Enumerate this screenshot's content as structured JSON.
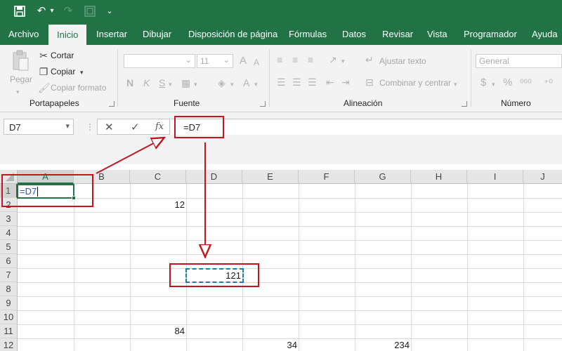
{
  "qat": {
    "save_icon": "save-icon",
    "undo_icon": "undo-icon",
    "redo_icon": "redo-icon",
    "form_icon": "form-icon",
    "customize_icon": "chevron-down-icon"
  },
  "tabs": [
    "Archivo",
    "Inicio",
    "Insertar",
    "Dibujar",
    "Disposición de página",
    "Fórmulas",
    "Datos",
    "Revisar",
    "Vista",
    "Programador",
    "Ayuda"
  ],
  "active_tab": "Inicio",
  "ribbon": {
    "clipboard": {
      "paste": "Pegar",
      "cut": "Cortar",
      "copy": "Copiar",
      "format_painter": "Copiar formato",
      "label": "Portapapeles"
    },
    "font": {
      "size": "11",
      "bold": "N",
      "italic": "K",
      "underline": "S",
      "grow": "A",
      "shrink": "A",
      "color": "A",
      "label": "Fuente"
    },
    "alignment": {
      "wrap": "Ajustar texto",
      "merge": "Combinar y centrar",
      "label": "Alineación"
    },
    "number": {
      "format": "General",
      "currency": "$",
      "percent": "%",
      "label": "Número"
    }
  },
  "formula_bar": {
    "name_box": "D7",
    "cancel": "✕",
    "enter": "✓",
    "fx": "fx",
    "formula": "=D7"
  },
  "grid": {
    "columns": [
      "A",
      "B",
      "C",
      "D",
      "E",
      "F",
      "G",
      "H",
      "I",
      "J"
    ],
    "rows": [
      "1",
      "2",
      "3",
      "4",
      "5",
      "6",
      "7",
      "8",
      "9",
      "10",
      "11",
      "12"
    ],
    "active_cell": "A1",
    "active_cell_value": "=D7",
    "referenced_cell": "D7",
    "cells": {
      "C2": "12",
      "D7": "121",
      "C11": "84",
      "E12": "34",
      "G12": "234"
    }
  },
  "colors": {
    "brand": "#217346",
    "annotation": "#c0161f",
    "marching_ants": "#1a7fa8"
  }
}
